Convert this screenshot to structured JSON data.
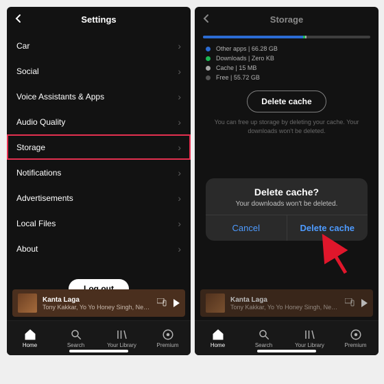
{
  "left": {
    "title": "Settings",
    "rows": [
      {
        "label": "Car"
      },
      {
        "label": "Social"
      },
      {
        "label": "Voice Assistants & Apps"
      },
      {
        "label": "Audio Quality"
      },
      {
        "label": "Storage",
        "highlight": true
      },
      {
        "label": "Notifications"
      },
      {
        "label": "Advertisements"
      },
      {
        "label": "Local Files"
      },
      {
        "label": "About"
      }
    ],
    "logout": "Log out"
  },
  "right": {
    "title": "Storage",
    "bar": [
      {
        "color": "#2c6cd3",
        "pct": 60
      },
      {
        "color": "#1db954",
        "pct": 1
      },
      {
        "color": "#a7a7a7",
        "pct": 1
      }
    ],
    "legend": [
      {
        "color": "#2c6cd3",
        "text": "Other apps | 66.28 GB"
      },
      {
        "color": "#1db954",
        "text": "Downloads | Zero KB"
      },
      {
        "color": "#a7a7a7",
        "text": "Cache | 15 MB"
      },
      {
        "color": "#535353",
        "text": "Free | 55.72 GB"
      }
    ],
    "delete_cache_btn": "Delete cache",
    "hint": "You can free up storage by deleting your cache. Your downloads won't be deleted.",
    "dialog": {
      "title": "Delete cache?",
      "subtitle": "Your downloads won't be deleted.",
      "cancel": "Cancel",
      "confirm": "Delete cache"
    }
  },
  "now_playing": {
    "title": "Kanta Laga",
    "artists": "Tony Kakkar, Yo Yo Honey Singh, Neha Kakkar"
  },
  "tabs": [
    {
      "label": "Home",
      "icon": "home",
      "active": true
    },
    {
      "label": "Search",
      "icon": "search"
    },
    {
      "label": "Your Library",
      "icon": "library"
    },
    {
      "label": "Premium",
      "icon": "premium"
    }
  ]
}
